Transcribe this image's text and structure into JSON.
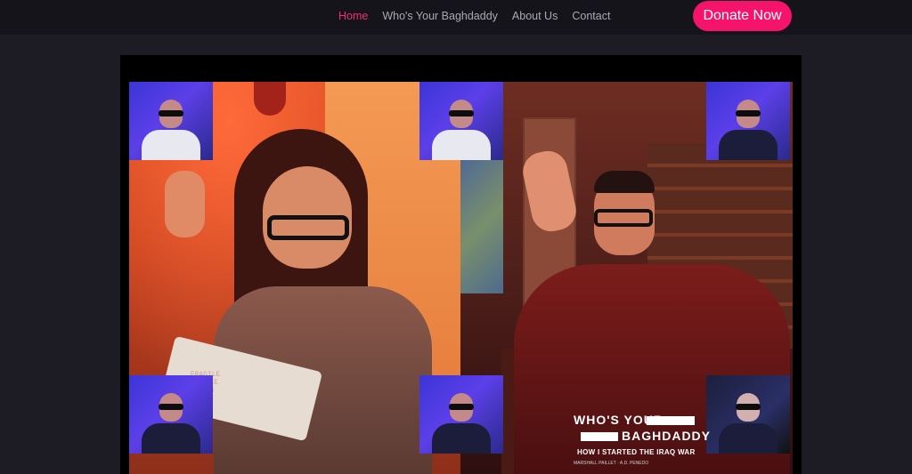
{
  "nav": {
    "items": [
      {
        "label": "Home",
        "active": true
      },
      {
        "label": "Who's Your Baghdaddy",
        "active": false
      },
      {
        "label": "About Us",
        "active": false
      },
      {
        "label": "Contact",
        "active": false
      }
    ],
    "donate_label": "Donate Now"
  },
  "colors": {
    "accent": "#f5136b",
    "nav_active": "#f0306e",
    "nav_text": "#a9a9b3",
    "page_bg": "#1d1b24",
    "topbar_bg": "#15141b"
  },
  "video": {
    "box_text": "FRAGILE\nHANDLE\nWITH\nCARE",
    "logo": {
      "line1": "WHO'S YOUR",
      "line2": "BAGHDADDY",
      "line3": "HOW I STARTED THE IRAQ WAR",
      "credits": "MARSHALL PAILLET · A.D. PENEDO"
    }
  }
}
